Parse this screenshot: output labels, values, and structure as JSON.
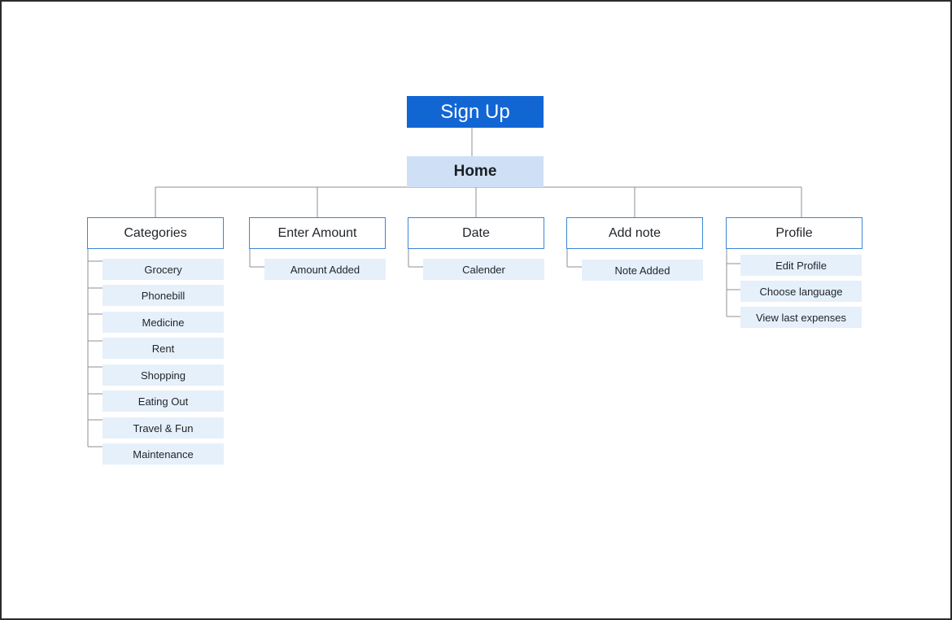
{
  "root": {
    "label": "Sign Up"
  },
  "home": {
    "label": "Home"
  },
  "sections": [
    {
      "label": "Categories",
      "items": [
        "Grocery",
        "Phonebill",
        "Medicine",
        "Rent",
        "Shopping",
        "Eating Out",
        "Travel & Fun",
        "Maintenance"
      ]
    },
    {
      "label": "Enter Amount",
      "items": [
        "Amount Added"
      ]
    },
    {
      "label": "Date",
      "items": [
        "Calender"
      ]
    },
    {
      "label": "Add note",
      "items": [
        "Note Added"
      ]
    },
    {
      "label": "Profile",
      "items": [
        "Edit Profile",
        "Choose language",
        "View last expenses"
      ]
    }
  ],
  "colors": {
    "signup_bg": "#1266d4",
    "home_bg": "#cfe0f6",
    "section_border": "#3b86d6",
    "item_bg": "#e6f0fb",
    "connector": "#8f8f8f"
  }
}
